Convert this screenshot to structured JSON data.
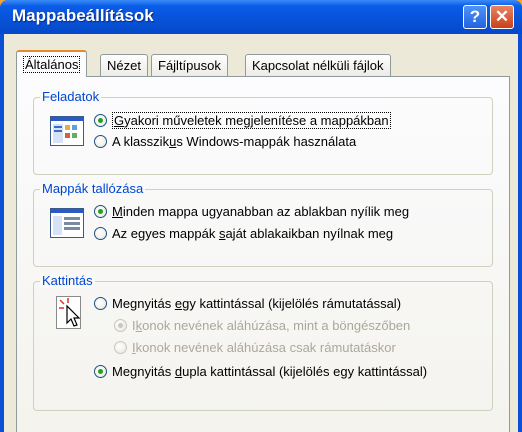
{
  "window": {
    "title": "Mappabeállítások",
    "help_label": "?",
    "close_label": "✕"
  },
  "tabs": [
    {
      "label": "Általános",
      "active": true
    },
    {
      "label": "Nézet",
      "active": false
    },
    {
      "label": "Fájltípusok",
      "active": false
    },
    {
      "label": "Kapcsolat nélküli fájlok",
      "active": false
    }
  ],
  "groups": {
    "tasks": {
      "label": "Feladatok",
      "icon": "web-view-folder-icon",
      "options": [
        {
          "pre": "",
          "u": "G",
          "post": "yakori műveletek megjelenítése a mappákban",
          "checked": true
        },
        {
          "pre": "A klasszik",
          "u": "u",
          "post": "s Windows-mappák használata",
          "checked": false
        }
      ]
    },
    "browse": {
      "label": "Mappák tallózása",
      "icon": "same-window-icon",
      "options": [
        {
          "pre": "",
          "u": "M",
          "post": "inden mappa ugyanabban az ablakban nyílik meg",
          "checked": true
        },
        {
          "pre": "Az egyes mappák ",
          "u": "s",
          "post": "aját ablakaikban nyílnak meg",
          "checked": false
        }
      ]
    },
    "click": {
      "label": "Kattintás",
      "icon": "pointer-click-icon",
      "options": [
        {
          "pre": "Megnyitás ",
          "u": "e",
          "post": "gy kattintással (kijelölés rámutatással)",
          "checked": false,
          "disabled": false
        },
        {
          "pre": "I",
          "u": "k",
          "post": "onok nevének aláhúzása, mint a böngészőben",
          "checked": true,
          "disabled": true
        },
        {
          "pre": "",
          "u": "I",
          "post": "konok nevének aláhúzása csak rámutatáskor",
          "checked": false,
          "disabled": true
        },
        {
          "pre": "Megnyitás ",
          "u": "d",
          "post": "upla kattintással (kijelölés egy kattintással)",
          "checked": true,
          "disabled": false
        }
      ]
    }
  },
  "colors": {
    "title_bar": "#0752d8",
    "group_label": "#0046d5",
    "active_tab_accent": "#e68b2c",
    "close_button": "#c9401c"
  }
}
